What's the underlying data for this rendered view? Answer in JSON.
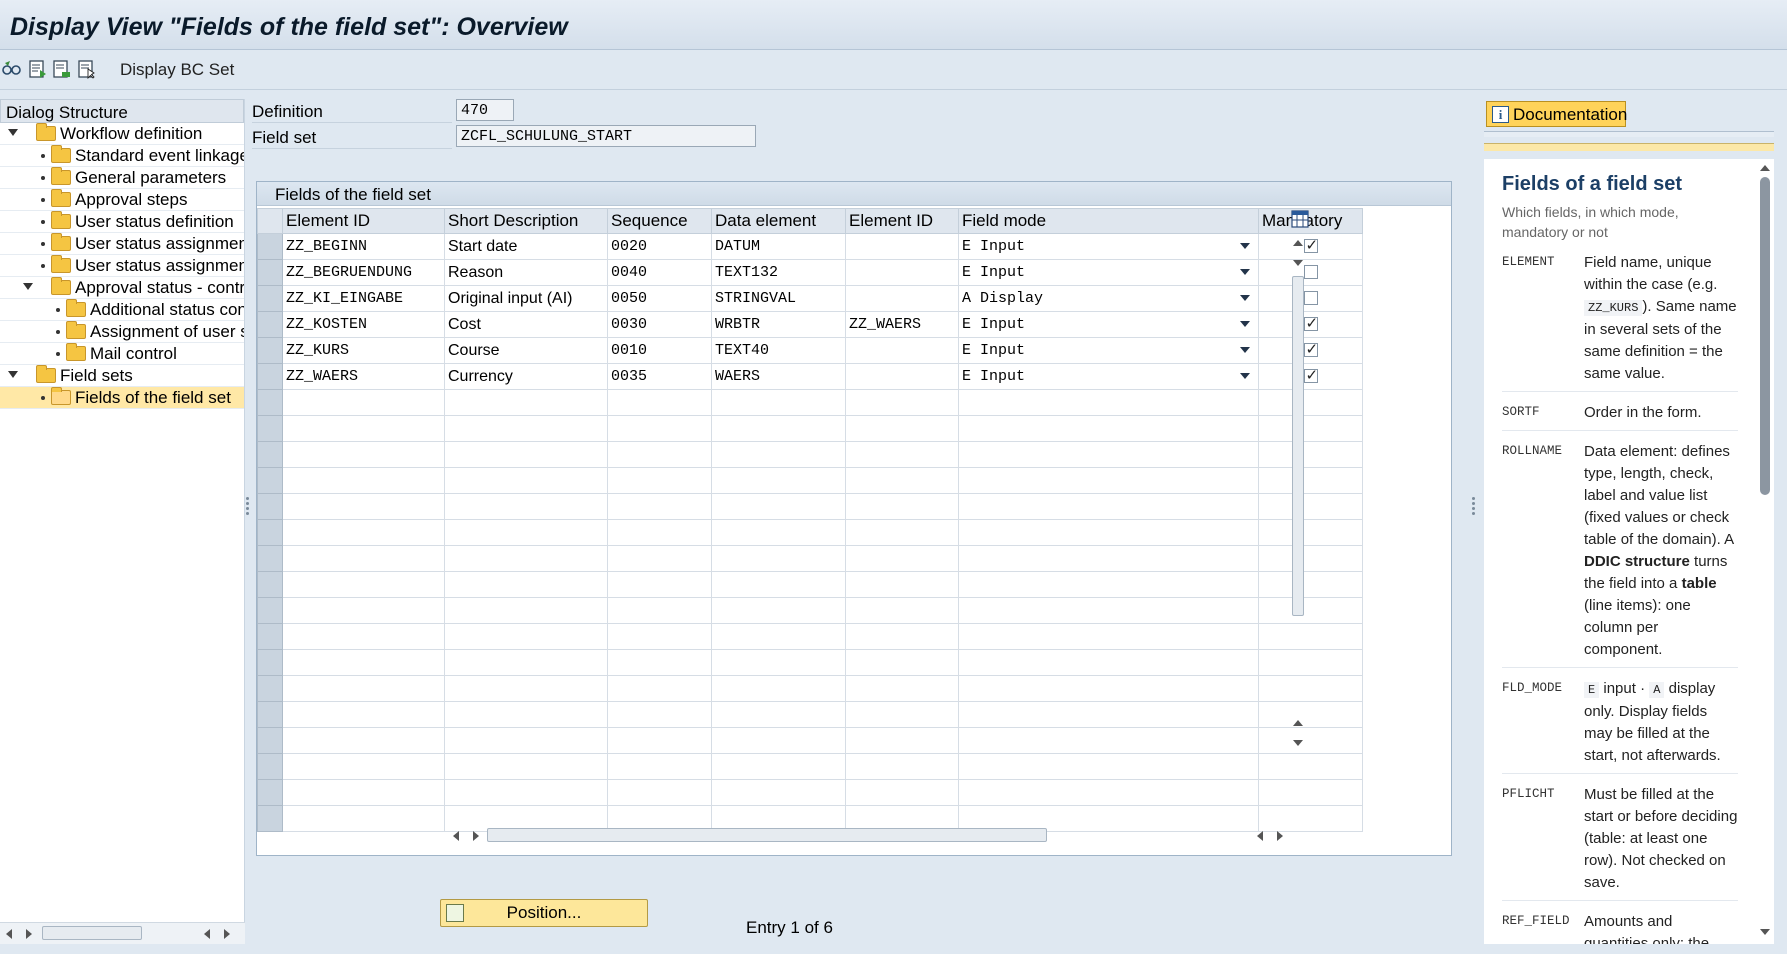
{
  "title": "Display View \"Fields of the field set\": Overview",
  "toolbar": {
    "display_bc_set": "Display BC Set",
    "icons": [
      "glasses-change-icon",
      "detail-icon",
      "export-icon",
      "select-icon"
    ]
  },
  "dialog_structure": {
    "header": "Dialog Structure",
    "items": [
      {
        "label": "Workflow definition",
        "level": 0,
        "expandable": true
      },
      {
        "label": "Standard event linkages",
        "level": 1
      },
      {
        "label": "General parameters",
        "level": 1
      },
      {
        "label": "Approval steps",
        "level": 1
      },
      {
        "label": "User status definition",
        "level": 1
      },
      {
        "label": "User status assignment (c",
        "level": 1
      },
      {
        "label": "User status assignment (d",
        "level": 1
      },
      {
        "label": "Approval status - control",
        "level": 1,
        "expandable": true
      },
      {
        "label": "Additional status contro",
        "level": 2
      },
      {
        "label": "Assignment of user stat",
        "level": 2
      },
      {
        "label": "Mail control",
        "level": 2
      },
      {
        "label": "Field sets",
        "level": 0,
        "expandable": true
      },
      {
        "label": "Fields of the field set",
        "level": 1,
        "selected": true
      }
    ]
  },
  "header_fields": {
    "definition_label": "Definition",
    "definition_value": "470",
    "field_set_label": "Field set",
    "field_set_value": "ZCFL_SCHULUNG_START"
  },
  "table": {
    "caption": "Fields of the field set",
    "columns": [
      "Element ID",
      "Short Description",
      "Sequence",
      "Data element",
      "Element ID",
      "Field mode",
      "Mandatory"
    ],
    "rows": [
      {
        "element_id": "ZZ_BEGINN",
        "short_desc": "Start date",
        "sequence": "0020",
        "data_element": "DATUM",
        "element_id2": "",
        "field_mode": "E Input",
        "mandatory": true
      },
      {
        "element_id": "ZZ_BEGRUENDUNG",
        "short_desc": "Reason",
        "sequence": "0040",
        "data_element": "TEXT132",
        "element_id2": "",
        "field_mode": "E Input",
        "mandatory": false
      },
      {
        "element_id": "ZZ_KI_EINGABE",
        "short_desc": "Original input (AI)",
        "sequence": "0050",
        "data_element": "STRINGVAL",
        "element_id2": "",
        "field_mode": "A Display",
        "mandatory": false
      },
      {
        "element_id": "ZZ_KOSTEN",
        "short_desc": "Cost",
        "sequence": "0030",
        "data_element": "WRBTR",
        "element_id2": "ZZ_WAERS",
        "field_mode": "E Input",
        "mandatory": true
      },
      {
        "element_id": "ZZ_KURS",
        "short_desc": "Course",
        "sequence": "0010",
        "data_element": "TEXT40",
        "element_id2": "",
        "field_mode": "E Input",
        "mandatory": true
      },
      {
        "element_id": "ZZ_WAERS",
        "short_desc": "Currency",
        "sequence": "0035",
        "data_element": "WAERS",
        "element_id2": "",
        "field_mode": "E Input",
        "mandatory": true
      }
    ],
    "empty_rows": 17
  },
  "footer": {
    "position_button": "Position...",
    "entry_text": "Entry 1 of 6"
  },
  "documentation": {
    "tab_label": "Documentation",
    "heading": "Fields of a field set",
    "subtitle": "Which fields, in which mode, mandatory or not",
    "entries": [
      {
        "key": "ELEMENT",
        "parts": [
          {
            "t": "Field name, unique within the case (e.g. "
          },
          {
            "c": "ZZ_KURS"
          },
          {
            "t": "). Same name in several sets of the same definition = the same value."
          }
        ]
      },
      {
        "key": "SORTF",
        "parts": [
          {
            "t": "Order in the form."
          }
        ]
      },
      {
        "key": "ROLLNAME",
        "parts": [
          {
            "t": "Data element: defines type, length, check, label and value list (fixed values or check table of the domain). A "
          },
          {
            "b": "DDIC structure"
          },
          {
            "t": " turns the field into a "
          },
          {
            "b": "table"
          },
          {
            "t": " (line items): one column per component."
          }
        ]
      },
      {
        "key": "FLD_MODE",
        "parts": [
          {
            "c": "E"
          },
          {
            "t": " input · "
          },
          {
            "c": "A"
          },
          {
            "t": " display only. Display fields may be filled at the start, not afterwards."
          }
        ]
      },
      {
        "key": "PFLICHT",
        "parts": [
          {
            "t": "Must be filled at the start or before deciding (table: at least one row). Not checked on save."
          }
        ]
      },
      {
        "key": "REF_FIELD",
        "parts": [
          {
            "t": "Amounts and quantities only: the"
          }
        ]
      }
    ]
  }
}
